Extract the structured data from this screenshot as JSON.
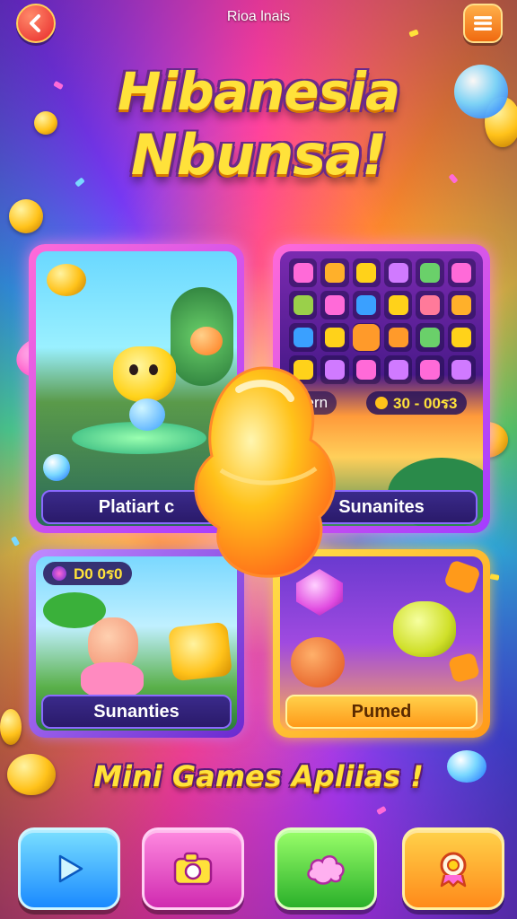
{
  "header": {
    "app_title": "Rioa lnais",
    "back_icon": "chevron-left-icon",
    "menu_icon": "hamburger-menu-icon"
  },
  "hero": {
    "title_line1": "Hibanesia",
    "title_line2": "Nbunsa!"
  },
  "cards": [
    {
      "label": "Platiart  c",
      "image": "cartoon-character-scene"
    },
    {
      "label": "Sunanites",
      "score": "30 - 00ร3",
      "tag": "kern",
      "image": "gem-match-grid"
    },
    {
      "label": "Sunanties",
      "score": "D0 0ร0",
      "image": "jungle-character-scene"
    },
    {
      "label": "Pumed",
      "image": "candy-creatures-scene"
    }
  ],
  "center_item": "candy-blob",
  "subtitle": "Mini Games Apliias !",
  "bottom_nav": [
    {
      "icon": "play-icon",
      "color": "#1a8aff"
    },
    {
      "icon": "camera-icon",
      "color": "#d02ab0"
    },
    {
      "icon": "cloud-icon",
      "color": "#2ab02a"
    },
    {
      "icon": "location-badge-icon",
      "color": "#ff8a1a"
    }
  ],
  "colors": {
    "title_yellow": "#ffe23a",
    "outline_purple": "#6a2a8a",
    "card_border_pink": "#ff6ad8",
    "card_border_gold": "#ffd04a"
  }
}
